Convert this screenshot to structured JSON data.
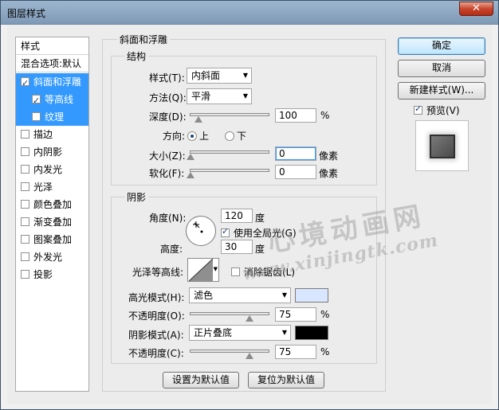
{
  "window": {
    "title": "图层样式",
    "close_glyph": "✕"
  },
  "sidebar": {
    "header": "样式",
    "blend_default": "混合选项:默认",
    "items": [
      {
        "label": "斜面和浮雕",
        "checked": true,
        "selected": true,
        "sub": false
      },
      {
        "label": "等高线",
        "checked": true,
        "selected": true,
        "sub": true
      },
      {
        "label": "纹理",
        "checked": false,
        "selected": true,
        "sub": true
      },
      {
        "label": "描边",
        "checked": false,
        "selected": false,
        "sub": false
      },
      {
        "label": "内阴影",
        "checked": false,
        "selected": false,
        "sub": false
      },
      {
        "label": "内发光",
        "checked": false,
        "selected": false,
        "sub": false
      },
      {
        "label": "光泽",
        "checked": false,
        "selected": false,
        "sub": false
      },
      {
        "label": "颜色叠加",
        "checked": false,
        "selected": false,
        "sub": false
      },
      {
        "label": "渐变叠加",
        "checked": false,
        "selected": false,
        "sub": false
      },
      {
        "label": "图案叠加",
        "checked": false,
        "selected": false,
        "sub": false
      },
      {
        "label": "外发光",
        "checked": false,
        "selected": false,
        "sub": false
      },
      {
        "label": "投影",
        "checked": false,
        "selected": false,
        "sub": false
      }
    ]
  },
  "bevel": {
    "title": "斜面和浮雕",
    "structure": {
      "title": "结构",
      "style_label": "样式(T):",
      "style_value": "内斜面",
      "technique_label": "方法(Q):",
      "technique_value": "平滑",
      "depth_label": "深度(D):",
      "depth_value": "100",
      "depth_fraction": 0.1,
      "percent": "%",
      "direction_label": "方向:",
      "direction_up": "上",
      "direction_down": "下",
      "size_label": "大小(Z):",
      "size_value": "0",
      "size_fraction": 0.0,
      "px_unit": "像素",
      "soften_label": "软化(F):",
      "soften_value": "0",
      "soften_fraction": 0.0
    },
    "shading": {
      "title": "阴影",
      "angle_label": "角度(N):",
      "angle_value": "120",
      "degree_unit": "度",
      "global_light_label": "使用全局光(G)",
      "altitude_label": "高度:",
      "altitude_value": "30",
      "gloss_contour_label": "光泽等高线:",
      "anti_alias_label": "消除锯齿(L)",
      "highlight_mode_label": "高光模式(H):",
      "highlight_mode_value": "滤色",
      "highlight_color": "#d9e6ff",
      "highlight_opacity_label": "不透明度(O):",
      "highlight_opacity_value": "75",
      "highlight_opacity_fraction": 0.75,
      "shadow_mode_label": "阴影模式(A):",
      "shadow_mode_value": "正片叠底",
      "shadow_color": "#000000",
      "shadow_opacity_label": "不透明度(C):",
      "shadow_opacity_value": "75",
      "shadow_opacity_fraction": 0.75,
      "percent": "%"
    },
    "set_default": "设置为默认值",
    "reset_default": "复位为默认值"
  },
  "buttons": {
    "ok": "确定",
    "cancel": "取消",
    "new_style": "新建样式(W)...",
    "preview": "预览(V)"
  },
  "watermark": {
    "line1": "心境动画网",
    "line2": "www.xinjingtk.com"
  }
}
